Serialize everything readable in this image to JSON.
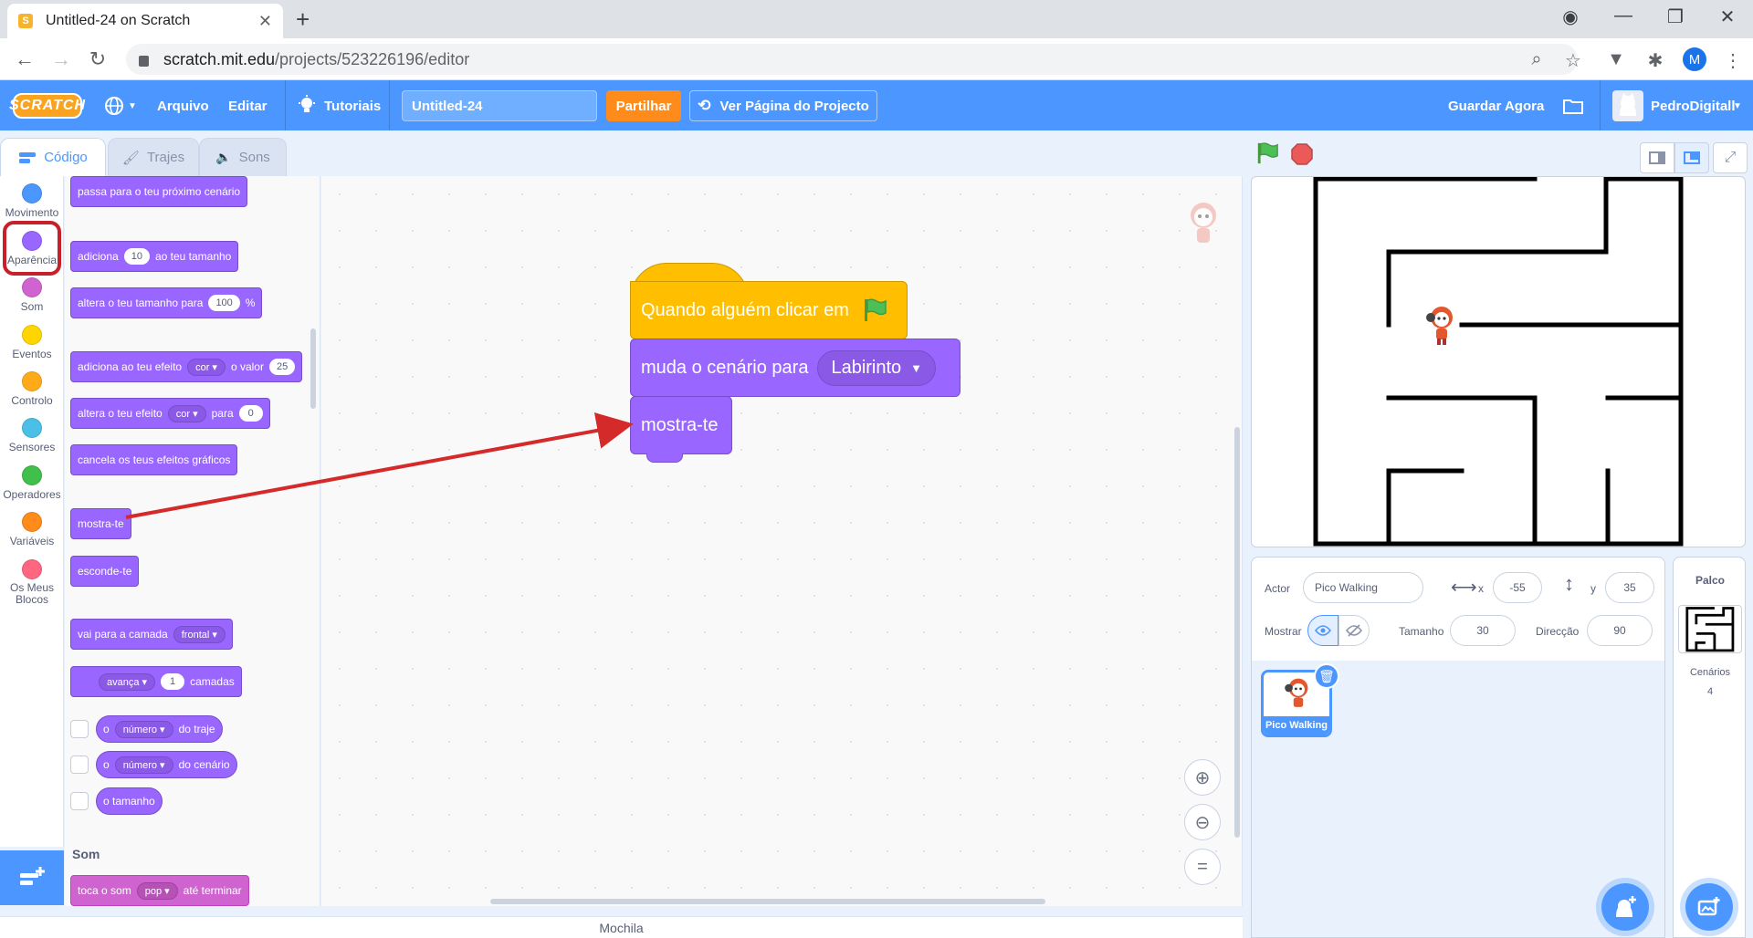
{
  "browser": {
    "tab_title": "Untitled-24 on Scratch",
    "url_host": "scratch.mit.edu",
    "url_path": "/projects/523226196/editor",
    "profile_initial": "M"
  },
  "menu": {
    "logo": "SCRATCH",
    "file": "Arquivo",
    "edit": "Editar",
    "tutorials": "Tutoriais",
    "project_title": "Untitled-24",
    "share": "Partilhar",
    "see_project": "Ver Página do Projecto",
    "save_now": "Guardar Agora",
    "username": "PedroDigitall"
  },
  "tabs": {
    "code": "Código",
    "costumes": "Trajes",
    "sounds": "Sons"
  },
  "categories": [
    {
      "label": "Movimento",
      "color": "#4c97ff"
    },
    {
      "label": "Aparência",
      "color": "#9966ff"
    },
    {
      "label": "Som",
      "color": "#cf63cf"
    },
    {
      "label": "Eventos",
      "color": "#ffd500"
    },
    {
      "label": "Controlo",
      "color": "#ffab19"
    },
    {
      "label": "Sensores",
      "color": "#4cbfe6"
    },
    {
      "label": "Operadores",
      "color": "#40bf4a"
    },
    {
      "label": "Variáveis",
      "color": "#ff8c1a"
    },
    {
      "label": "Os Meus Blocos",
      "color": "#ff6680"
    }
  ],
  "palette": {
    "next_backdrop": "passa para o teu próximo cenário",
    "change_size_a": "adiciona",
    "change_size_val": "10",
    "change_size_b": "ao teu tamanho",
    "set_size_a": "altera o teu tamanho para",
    "set_size_val": "100",
    "set_size_b": "%",
    "change_effect_a": "adiciona ao teu efeito",
    "change_effect_drop": "cor",
    "change_effect_b": "o valor",
    "change_effect_val": "25",
    "set_effect_a": "altera o teu efeito",
    "set_effect_drop": "cor",
    "set_effect_b": "para",
    "set_effect_val": "0",
    "clear_effects": "cancela os teus efeitos gráficos",
    "show": "mostra-te",
    "hide": "esconde-te",
    "goto_layer_a": "vai para a camada",
    "goto_layer_drop": "frontal",
    "layer_drop": "avança",
    "layer_val": "1",
    "layer_b": "camadas",
    "costume_a": "o",
    "costume_drop": "número",
    "costume_b": "do traje",
    "backdrop_a": "o",
    "backdrop_drop": "número",
    "backdrop_b": "do cenário",
    "size": "o tamanho",
    "sound_heading": "Som",
    "play_sound_a": "toca o som",
    "play_sound_drop": "pop",
    "play_sound_b": "até terminar"
  },
  "script": {
    "hat": "Quando alguém clicar em",
    "switch_backdrop": "muda o cenário para",
    "backdrop_value": "Labirinto",
    "show": "mostra-te"
  },
  "backpack": "Mochila",
  "sprite": {
    "actor_label": "Actor",
    "name": "Pico Walking",
    "x_label": "x",
    "x": "-55",
    "y_label": "y",
    "y": "35",
    "show_label": "Mostrar",
    "size_label": "Tamanho",
    "size": "30",
    "direction_label": "Direcção",
    "direction": "90",
    "thumb_name": "Pico Walking"
  },
  "stage_panel": {
    "title": "Palco",
    "backdrops_label": "Cenários",
    "backdrops_count": "4"
  },
  "colors": {
    "accent": "#4c97ff",
    "looks": "#9966ff",
    "events": "#ffbf00",
    "highlight": "#c8202a"
  }
}
